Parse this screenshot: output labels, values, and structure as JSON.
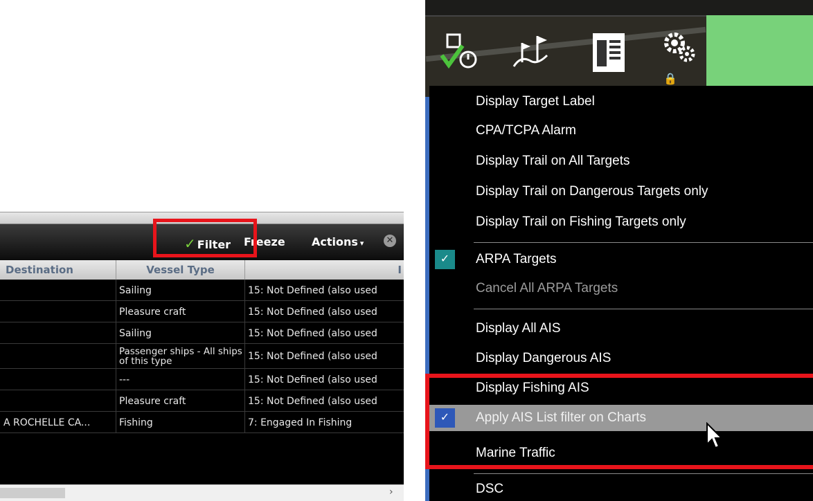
{
  "toolbar": {
    "filter_label": "Filter",
    "freeze_label": "Freeze",
    "actions_label": "Actions",
    "actions_caret": "▾",
    "close_glyph": "✕",
    "filter_check": "✓"
  },
  "table": {
    "headers": {
      "destination": "Destination",
      "vessel_type": "Vessel Type",
      "status": "I"
    },
    "rows": [
      {
        "destination": "",
        "vessel_type": "Sailing",
        "status": "15: Not Defined (also used"
      },
      {
        "destination": "",
        "vessel_type": "Pleasure craft",
        "status": "15: Not Defined (also used"
      },
      {
        "destination": "",
        "vessel_type": "Sailing",
        "status": "15: Not Defined (also used"
      },
      {
        "destination": "",
        "vessel_type": "Passenger ships - All ships of this type",
        "status": "15: Not Defined (also used"
      },
      {
        "destination": "",
        "vessel_type": "---",
        "status": "15: Not Defined (also used"
      },
      {
        "destination": "",
        "vessel_type": "Pleasure craft",
        "status": "15: Not Defined (also used"
      },
      {
        "destination": "A ROCHELLE CA...",
        "vessel_type": "Fishing",
        "status": "7: Engaged In Fishing"
      }
    ],
    "scroll_right_glyph": "›"
  },
  "menu": {
    "items": {
      "display_target_label": "Display Target Label",
      "cpa_tcpa_alarm": "CPA/TCPA Alarm",
      "trail_all": "Display Trail on All Targets",
      "trail_dangerous": "Display Trail on Dangerous Targets only",
      "trail_fishing": "Display Trail on Fishing Targets only",
      "arpa_targets": "ARPA Targets",
      "cancel_arpa": "Cancel All ARPA Targets",
      "display_all_ais": "Display All AIS",
      "display_dangerous_ais": "Display Dangerous AIS",
      "display_fishing_ais": "Display Fishing AIS",
      "apply_filter": "Apply AIS List filter on Charts",
      "marine_traffic": "Marine Traffic",
      "dsc": "DSC"
    },
    "check_glyph": "✓"
  },
  "icons": {
    "lock_glyph": "🔒"
  },
  "colors": {
    "highlight_red": "#e8141b",
    "check_teal": "#1a8a8a",
    "check_blue": "#2e58b8",
    "hover_gray": "#999999",
    "filter_green": "#79d13c"
  }
}
